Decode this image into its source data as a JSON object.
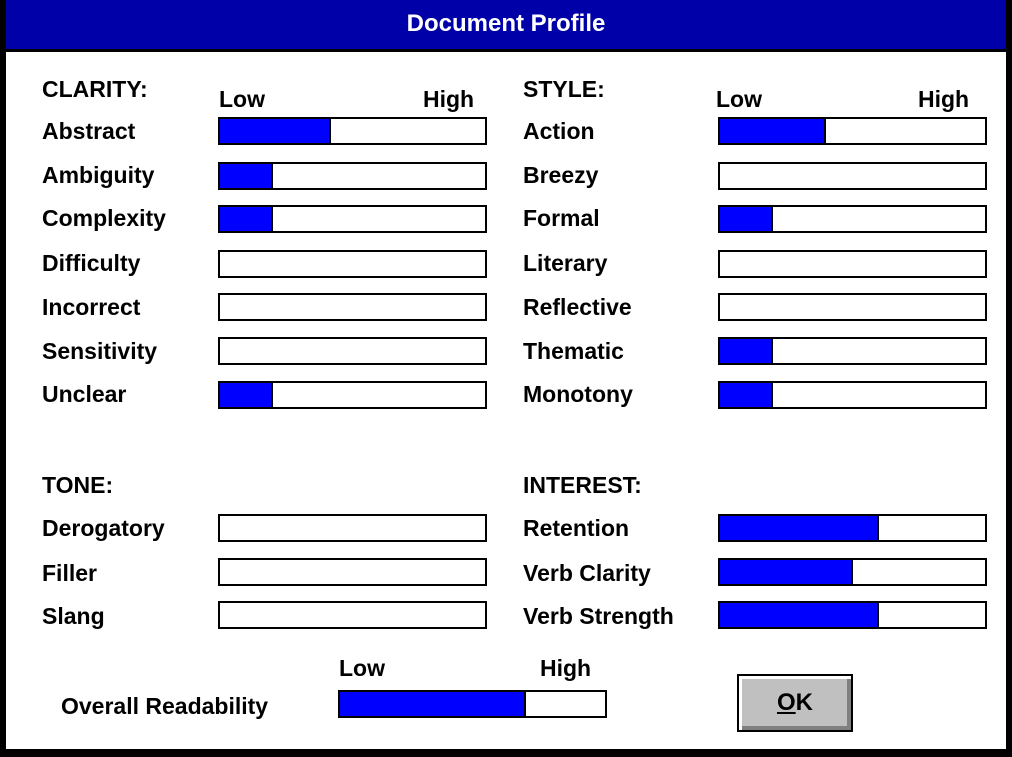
{
  "dialog": {
    "title": "Document Profile",
    "ok_label": "OK",
    "ok_mnemonic": "O",
    "ok_rest": "K",
    "accent": "#0000ff",
    "titlebar_color": "#0000a8"
  },
  "clarity": {
    "heading": "CLARITY:",
    "low": "Low",
    "high": "High",
    "items": [
      {
        "label": "Abstract",
        "level": 0.42
      },
      {
        "label": "Ambiguity",
        "level": 0.2
      },
      {
        "label": "Complexity",
        "level": 0.2
      },
      {
        "label": "Difficulty",
        "level": 0
      },
      {
        "label": "Incorrect",
        "level": 0
      },
      {
        "label": "Sensitivity",
        "level": 0
      },
      {
        "label": "Unclear",
        "level": 0.2
      }
    ]
  },
  "style": {
    "heading": "STYLE:",
    "low": "Low",
    "high": "High",
    "items": [
      {
        "label": "Action",
        "level": 0.4
      },
      {
        "label": "Breezy",
        "level": 0
      },
      {
        "label": "Formal",
        "level": 0.2
      },
      {
        "label": "Literary",
        "level": 0
      },
      {
        "label": "Reflective",
        "level": 0
      },
      {
        "label": "Thematic",
        "level": 0.2
      },
      {
        "label": "Monotony",
        "level": 0.2
      }
    ]
  },
  "tone": {
    "heading": "TONE:",
    "items": [
      {
        "label": "Derogatory",
        "level": 0
      },
      {
        "label": "Filler",
        "level": 0
      },
      {
        "label": "Slang",
        "level": 0
      }
    ]
  },
  "interest": {
    "heading": "INTEREST:",
    "items": [
      {
        "label": "Retention",
        "level": 0.6
      },
      {
        "label": "Verb Clarity",
        "level": 0.5
      },
      {
        "label": "Verb Strength",
        "level": 0.6
      }
    ]
  },
  "overall": {
    "label": "Overall Readability",
    "low": "Low",
    "high": "High",
    "level": 0.7
  }
}
